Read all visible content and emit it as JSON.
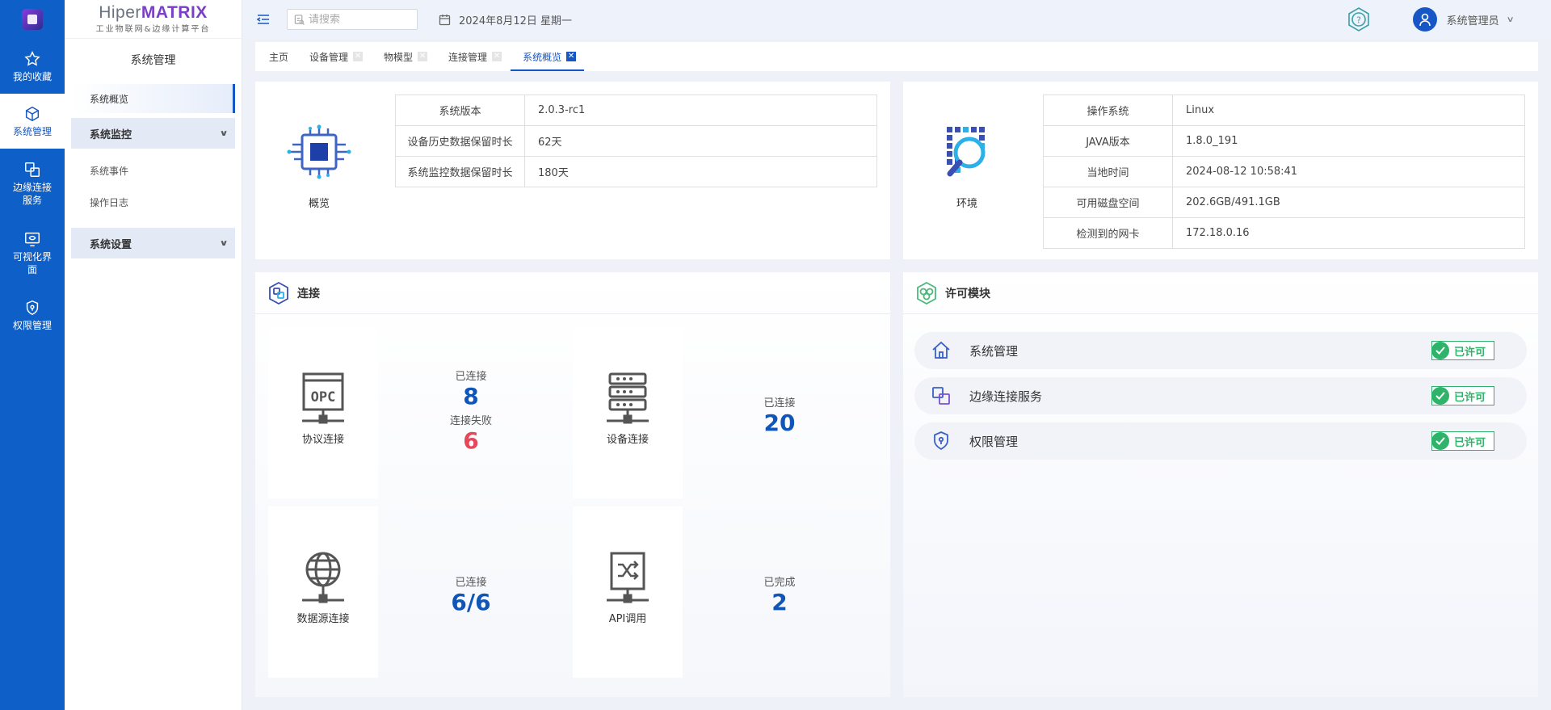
{
  "app": {
    "brand_plain": "Hiper",
    "brand_bold": "MATRIX",
    "brand_sub": "工业物联网&边缘计算平台"
  },
  "rail": {
    "items": [
      {
        "label": "我的收藏",
        "icon": "star-icon"
      },
      {
        "label": "系统管理",
        "icon": "cube-icon"
      },
      {
        "label": "边缘连接服务",
        "icon": "edge-link-icon"
      },
      {
        "label": "可视化界面",
        "icon": "monitor-eye-icon"
      },
      {
        "label": "权限管理",
        "icon": "shield-icon"
      }
    ]
  },
  "subnav": {
    "title": "系统管理",
    "overview": "系统概览",
    "monitor_group": "系统监控",
    "events": "系统事件",
    "oplog": "操作日志",
    "settings_group": "系统设置"
  },
  "header": {
    "search_placeholder": "请搜索",
    "date": "2024年8月12日 星期一",
    "user": "系统管理员"
  },
  "tabs": [
    "主页",
    "设备管理",
    "物模型",
    "连接管理",
    "系统概览"
  ],
  "overview": {
    "label": "概览",
    "rows": [
      {
        "k": "系统版本",
        "v": "2.0.3-rc1"
      },
      {
        "k": "设备历史数据保留时长",
        "v": "62天"
      },
      {
        "k": "系统监控数据保留时长",
        "v": "180天"
      }
    ]
  },
  "env": {
    "label": "环境",
    "rows": [
      {
        "k": "操作系统",
        "v": "Linux"
      },
      {
        "k": "JAVA版本",
        "v": "1.8.0_191"
      },
      {
        "k": "当地时间",
        "v": "2024-08-12 10:58:41"
      },
      {
        "k": "可用磁盘空间",
        "v": "202.6GB/491.1GB"
      },
      {
        "k": "检测到的网卡",
        "v": "172.18.0.16"
      }
    ]
  },
  "connection": {
    "title": "连接",
    "protocol": {
      "label": "协议连接",
      "connected_label": "已连接",
      "connected": "8",
      "failed_label": "连接失败",
      "failed": "6"
    },
    "device": {
      "label": "设备连接",
      "connected_label": "已连接",
      "connected": "20"
    },
    "datasource": {
      "label": "数据源连接",
      "connected_label": "已连接",
      "connected": "6/6"
    },
    "api": {
      "label": "API调用",
      "done_label": "已完成",
      "done": "2"
    }
  },
  "license": {
    "title": "许可模块",
    "badge": "已许可",
    "items": [
      "系统管理",
      "边缘连接服务",
      "权限管理"
    ]
  },
  "colors": {
    "primary": "#1657c5",
    "rail": "#0f5fc8",
    "number_blue": "#0f56b8",
    "number_red": "#e6485a",
    "licensed_green": "#2fb36b"
  }
}
